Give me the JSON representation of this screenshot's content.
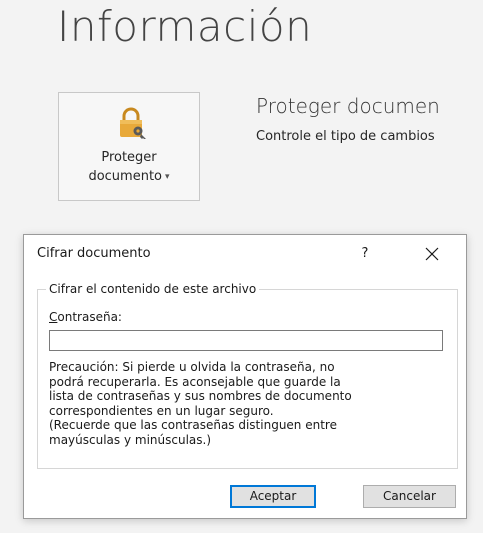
{
  "page": {
    "title": "Información"
  },
  "protect": {
    "tile_line1": "Proteger",
    "tile_line2": "documento",
    "tile_caret": "▾",
    "heading": "Proteger documen",
    "description": "Controle el tipo de cambios",
    "icon": "lock-key-icon",
    "lock_color": "#e8a93a"
  },
  "dialog": {
    "title": "Cifrar documento",
    "help_label": "?",
    "close_icon": "close-icon",
    "group_legend": "Cifrar el contenido de este archivo",
    "password_label_mnemonic": "C",
    "password_label_rest": "ontraseña:",
    "password_value": "",
    "warning_lines": [
      "Precaución: Si pierde u olvida la contraseña, no",
      "podrá recuperarla. Es aconsejable que guarde la",
      "lista de contraseñas y sus nombres de documento",
      "correspondientes en un lugar seguro.",
      "(Recuerde que las contraseñas distinguen entre",
      "mayúsculas y minúsculas.)"
    ],
    "ok_label": "Aceptar",
    "cancel_label": "Cancelar",
    "accent_color": "#0078d7"
  }
}
